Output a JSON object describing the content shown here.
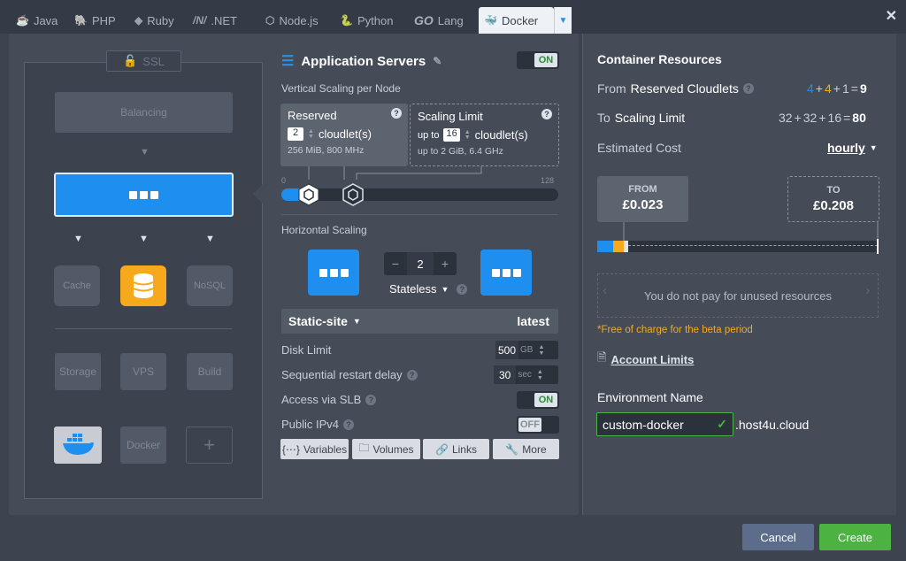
{
  "tabs": [
    {
      "label": "Java",
      "icon": "java-icon"
    },
    {
      "label": "PHP",
      "icon": "php-icon"
    },
    {
      "label": "Ruby",
      "icon": "ruby-icon"
    },
    {
      "label": ".NET",
      "icon": "dotnet-icon"
    },
    {
      "label": "Node.js",
      "icon": "nodejs-icon"
    },
    {
      "label": "Python",
      "icon": "python-icon"
    },
    {
      "label": "Lang",
      "icon": "go-icon",
      "prefix": "GO"
    },
    {
      "label": "Docker",
      "icon": "docker-icon",
      "active": true
    }
  ],
  "topology": {
    "ssl": "SSL",
    "balancing": "Balancing",
    "cache": "Cache",
    "nosql": "NoSQL",
    "storage": "Storage",
    "vps": "VPS",
    "build": "Build",
    "docker": "Docker"
  },
  "config": {
    "title": "Application Servers",
    "title_toggle": "ON",
    "vertical_label": "Vertical Scaling per Node",
    "reserved": {
      "title": "Reserved",
      "value": "2",
      "unit": "cloudlet(s)",
      "sub": "256 MiB, 800 MHz"
    },
    "limit": {
      "title": "Scaling Limit",
      "prefix": "up to",
      "value": "16",
      "unit": "cloudlet(s)",
      "sub": "up to 2 GiB, 6.4 GHz"
    },
    "slider": {
      "min": "0",
      "max": "128"
    },
    "horizontal_label": "Horizontal Scaling",
    "node_count": "2",
    "mode": "Stateless",
    "image": "Static-site",
    "image_tag": "latest",
    "disk_label": "Disk Limit",
    "disk_value": "500",
    "disk_unit": "GB",
    "restart_label": "Sequential restart delay",
    "restart_value": "30",
    "restart_unit": "sec",
    "slb_label": "Access via SLB",
    "slb_toggle": "ON",
    "ipv4_label": "Public IPv4",
    "ipv4_toggle": "OFF",
    "buttons": {
      "variables": "Variables",
      "volumes": "Volumes",
      "links": "Links",
      "more": "More"
    }
  },
  "resources": {
    "title": "Container Resources",
    "reserved_label_a": "From",
    "reserved_label_b": "Reserved Cloudlets",
    "reserved_parts": [
      "4",
      "4",
      "1"
    ],
    "reserved_total": "9",
    "limit_label_a": "To",
    "limit_label_b": "Scaling Limit",
    "limit_parts": [
      "32",
      "32",
      "16"
    ],
    "limit_total": "80",
    "cost_label": "Estimated Cost",
    "cost_period": "hourly",
    "from_label": "FROM",
    "from_value": "£0.023",
    "to_label": "TO",
    "to_value": "£0.208",
    "unused_text": "You do not pay for unused resources",
    "beta_note": "*Free of charge for the beta period",
    "account_limits": "Account Limits",
    "env_label": "Environment Name",
    "env_value": "custom-docker",
    "env_domain": ".host4u.cloud"
  },
  "footer": {
    "cancel": "Cancel",
    "create": "Create"
  },
  "colors": {
    "accent": "#1e8fef",
    "success": "#4db340",
    "warning": "#f6a91c",
    "cancel": "#5c6d8c"
  }
}
